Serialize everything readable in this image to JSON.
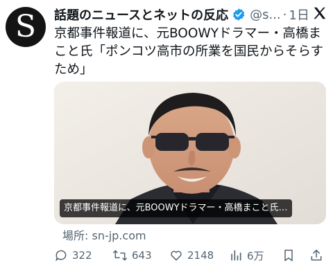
{
  "account": {
    "avatar_letter": "S",
    "name": "話題のニュースとネットの反応",
    "handle": "@s...",
    "separator": "·",
    "time": "1日"
  },
  "post": {
    "text": "京都事件報道に、元BOOWYドラマー・高橋まこと氏「ポンコツ高市の所業を国民からそらすため」"
  },
  "media": {
    "caption": "京都事件報道に、元BOOWYドラマー・高橋まこと氏…"
  },
  "source": {
    "label": "場所: sn-jp.com"
  },
  "actions": {
    "replies": "322",
    "reposts": "643",
    "likes": "2148",
    "views": "6万"
  },
  "colors": {
    "verified": "#1d9bf0",
    "muted": "#536471",
    "text": "#0f1419"
  },
  "icons": [
    "x-logo-icon",
    "verified-badge-icon",
    "reply-icon",
    "repost-icon",
    "like-icon",
    "views-icon",
    "bookmark-icon",
    "share-icon"
  ]
}
